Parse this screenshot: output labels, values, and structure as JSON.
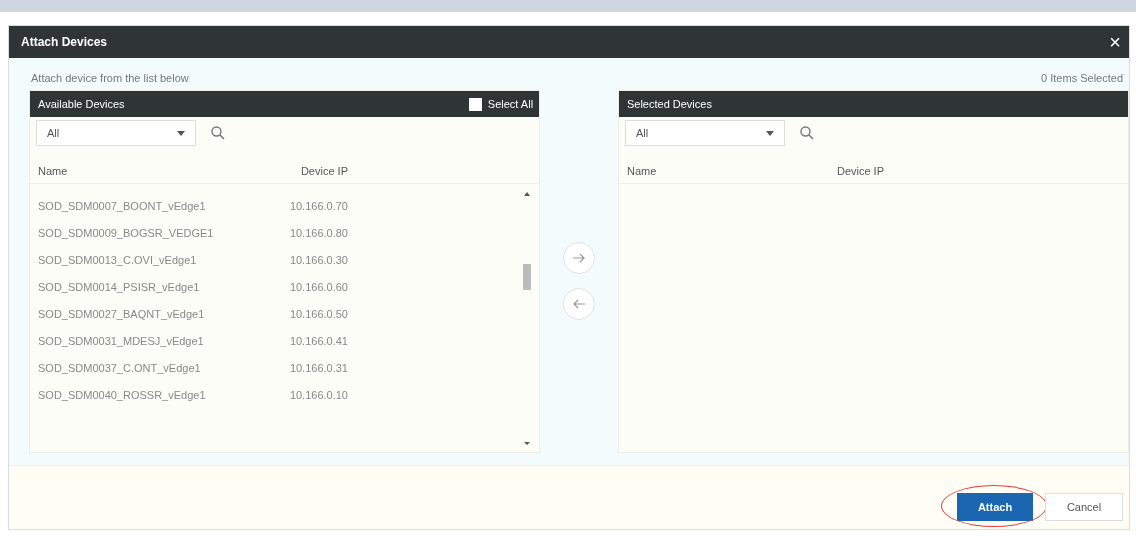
{
  "dialog": {
    "title": "Attach Devices",
    "close": "×"
  },
  "subtitle": "Attach device from the list below",
  "selected_count": "0 Items Selected",
  "available": {
    "title": "Available Devices",
    "select_all": {
      "label": "Select All",
      "checked": false
    },
    "filter": "All",
    "columns": [
      "Name",
      "Device IP"
    ],
    "rows": [
      {
        "name": "SOD_SDM0007_BOONT_vEdge1",
        "ip": "10.166.0.70"
      },
      {
        "name": "SOD_SDM0009_BOGSR_VEDGE1",
        "ip": "10.166.0.80"
      },
      {
        "name": "SOD_SDM0013_C.OVI_vEdge1",
        "ip": "10.166.0.30"
      },
      {
        "name": "SOD_SDM0014_PSISR_vEdge1",
        "ip": "10.166.0.60"
      },
      {
        "name": "SOD_SDM0027_BAQNT_vEdge1",
        "ip": "10.166.0.50"
      },
      {
        "name": "SOD_SDM0031_MDESJ_vEdge1",
        "ip": "10.166.0.41"
      },
      {
        "name": "SOD_SDM0037_C.ONT_vEdge1",
        "ip": "10.166.0.31"
      },
      {
        "name": "SOD_SDM0040_ROSSR_vEdge1",
        "ip": "10.166.0.10"
      }
    ]
  },
  "selected": {
    "title": "Selected Devices",
    "filter": "All",
    "columns": [
      "Name",
      "Device IP"
    ]
  },
  "buttons": [
    {
      "label": "Attach",
      "kind": "primary",
      "highlighted": true
    },
    {
      "label": "Cancel",
      "kind": "secondary",
      "highlighted": false
    }
  ]
}
